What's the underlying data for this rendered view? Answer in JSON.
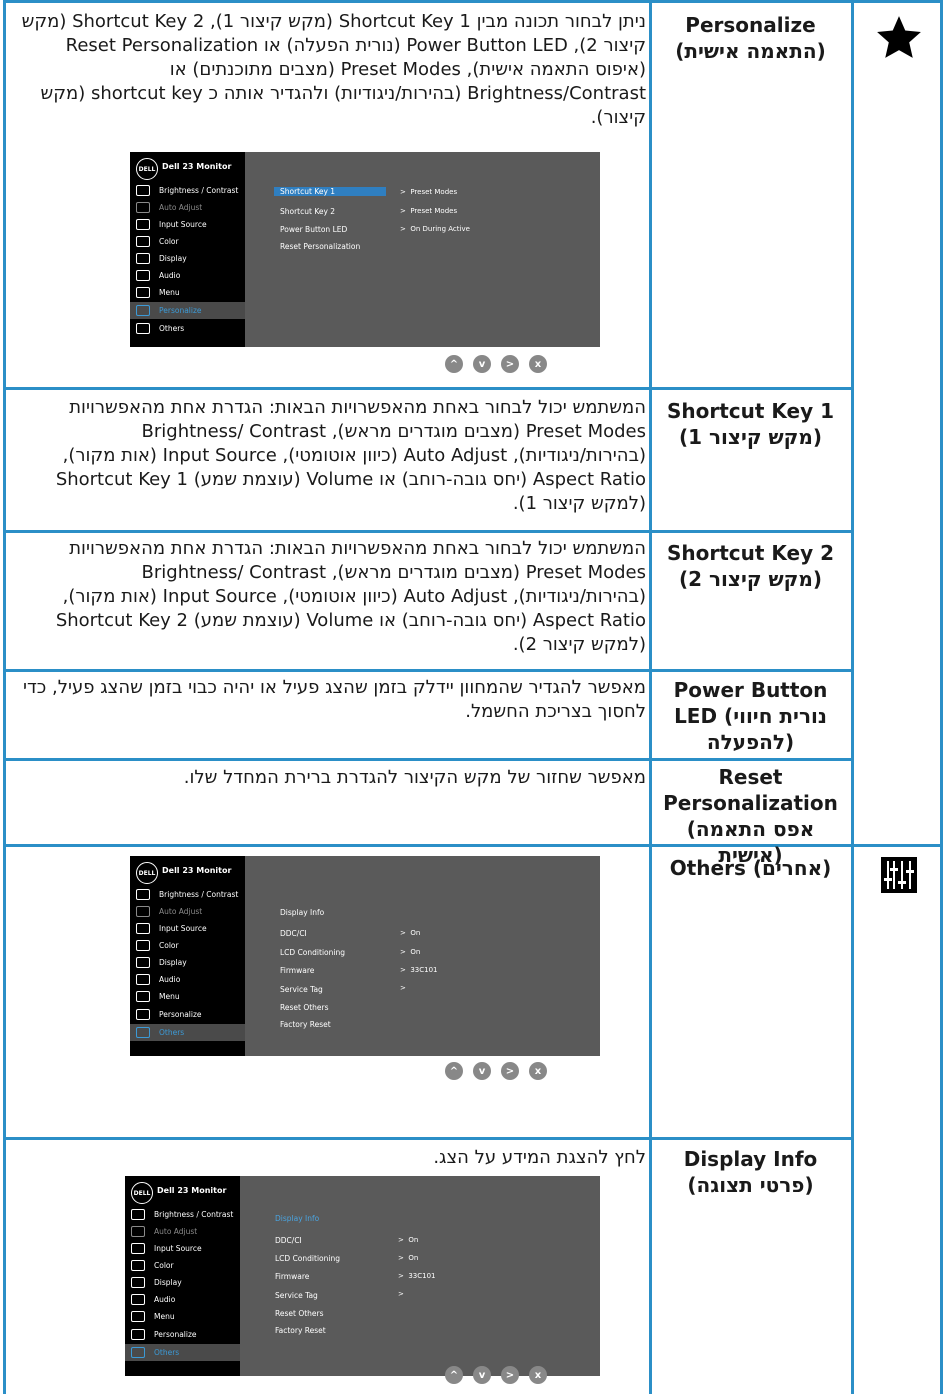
{
  "rows": [
    {
      "term": "Personalize (התאמה אישית)",
      "desc": "ניתן לבחור תכונה מבין Shortcut Key 1 (מקש קיצור 1), Shortcut Key 2 (מקש קיצור 2), Power Button LED (נורית הפעלה) או Reset Personalization (איפוס התאמה אישית), Preset Modes (מצבים מתוכנתים) או Brightness/Contrast (בהירות/ניגודיות) ולהגדיר אותה כ shortcut key (מקש קיצור)."
    },
    {
      "term": "Shortcut Key 1 (מקש קיצור 1)",
      "desc": "המשתמש יכול לבחור באחת מהאפשרויות הבאות: הגדרת אחת מהאפשרויות Preset Modes (מצבים מוגדרים מראש), Brightness/ Contrast (בהירות/ניגודיות), Auto Adjust (כיוון אוטומטי), Input Source (אות מקור), Aspect Ratio (יחס גובה-רוחב) או Volume (עוצמת שמע) Shortcut Key 1 (למקש קיצור 1)."
    },
    {
      "term": "Shortcut Key 2 (מקש קיצור 2)",
      "desc": "המשתמש יכול לבחור באחת מהאפשרויות הבאות: הגדרת אחת מהאפשרויות Preset Modes (מצבים מוגדרים מראש), Brightness/ Contrast (בהירות/ניגודיות), Auto Adjust (כיוון אוטומטי), Input Source (אות מקור), Aspect Ratio (יחס גובה-רוחב) או Volume (עוצמת שמע) Shortcut Key 2 (למקש קיצור 2)."
    },
    {
      "term": "Power Button LED (נורית חיווי להפעלה)",
      "desc": "מאפשר להגדיר שהמחוון יידלק בזמן שהצג פעיל או יהיה כבוי בזמן שהצג פעיל, כדי לחסוך בצריכת החשמל."
    },
    {
      "term": "Reset Personalization (אפס התאמה אישית)",
      "desc": "מאפשר שחזור של מקש הקיצור להגדרת ברירת המחדל שלו."
    },
    {
      "term": "Others (אחרים)",
      "desc": ""
    },
    {
      "term": "Display Info (פרטי תצוגה)",
      "desc": "לחץ להצגת המידע על הצג."
    }
  ],
  "osd": {
    "brand": "DELL",
    "model": "Dell 23 Monitor",
    "menu": [
      "Brightness / Contrast",
      "Auto Adjust",
      "Input Source",
      "Color",
      "Display",
      "Audio",
      "Menu",
      "Personalize",
      "Others"
    ],
    "personalize_options": [
      "Shortcut Key 1",
      "Shortcut Key 2",
      "Power Button LED",
      "Reset Personalization"
    ],
    "personalize_values": [
      "Preset Modes",
      "Preset Modes",
      "On During Active"
    ],
    "others_options": [
      "Display Info",
      "DDC/CI",
      "LCD Conditioning",
      "Firmware",
      "Service Tag",
      "Reset Others",
      "Factory Reset"
    ],
    "others_values": [
      "On",
      "On",
      "33C101",
      ""
    ]
  }
}
